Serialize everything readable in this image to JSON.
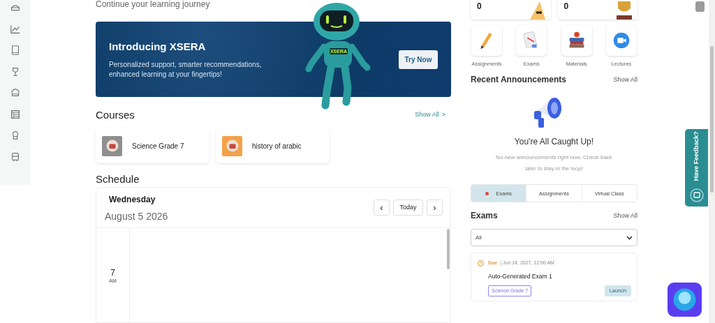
{
  "sidebar": {
    "items": [
      {
        "kind": "hat",
        "selected": false
      },
      {
        "kind": "chart",
        "selected": false
      },
      {
        "kind": "book",
        "selected": false
      },
      {
        "kind": "trophy",
        "selected": false
      },
      {
        "kind": "chef",
        "selected": false
      },
      {
        "kind": "table",
        "selected": false
      },
      {
        "kind": "award",
        "selected": false
      },
      {
        "kind": "bus",
        "selected": false
      }
    ]
  },
  "subtitle": "Continue your learning journey",
  "banner": {
    "title": "Introducing XSERA",
    "text": "Personalized support, smarter recommendations, enhanced learning at your fingertips!",
    "robot_label": "XSERA",
    "button": "Try Now"
  },
  "courses": {
    "title": "Courses",
    "show_all": "Show All",
    "show_all_icon": ">",
    "items": [
      {
        "name": "Science Grade 7",
        "color": "#8f8f8f"
      },
      {
        "name": "history of arabic",
        "color": "#f5a04a"
      }
    ]
  },
  "schedule": {
    "title": "Schedule",
    "day": "Wednesday",
    "date": "August 5 2026",
    "prev": "‹",
    "today": "Today",
    "next": "›",
    "hours": [
      {
        "hour": "7",
        "period": "AM"
      }
    ]
  },
  "stats": [
    {
      "value": "0",
      "kind": "cheese"
    },
    {
      "value": "0",
      "kind": "trophy"
    }
  ],
  "shortcuts": [
    {
      "label": "Assignments",
      "kind": "pencil"
    },
    {
      "label": "Exams",
      "kind": "paper"
    },
    {
      "label": "Materials",
      "kind": "books"
    },
    {
      "label": "Lectures",
      "kind": "camera"
    }
  ],
  "announcements": {
    "title": "Recent Announcements",
    "show_all": "Show All",
    "empty_title": "You're All Caught Up!",
    "empty_text": "No new announcements right now. Check back later to stay in the loop!"
  },
  "tabs": [
    {
      "label": "Exams",
      "selected": true
    },
    {
      "label": "Assignments",
      "selected": false
    },
    {
      "label": "Virtual Class",
      "selected": false
    }
  ],
  "exams": {
    "title": "Exams",
    "show_all": "Show All",
    "filter": "All",
    "items": [
      {
        "status": "Due",
        "date": "| Jun 24, 2027, 12:00 AM",
        "name": "Auto-Generated Exam 1",
        "course": "Science Grade 7",
        "action": "Launch"
      }
    ]
  },
  "feedback": {
    "label": "Have Feedback?"
  }
}
